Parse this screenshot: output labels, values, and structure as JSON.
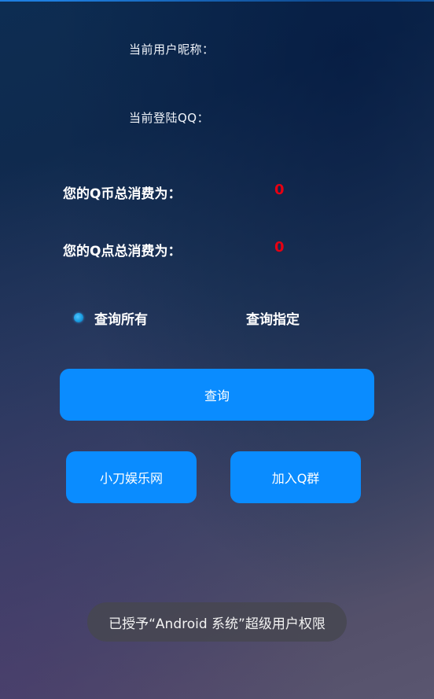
{
  "info": {
    "nickname_label": "当前用户昵称：",
    "qq_label": "当前登陆QQ："
  },
  "stats": {
    "qcoin_label": "您的Q币总消费为：",
    "qcoin_value": "0",
    "qpoint_label": "您的Q点总消费为：",
    "qpoint_value": "0"
  },
  "options": {
    "query_all": "查询所有",
    "query_specific": "查询指定",
    "selected": "查询所有"
  },
  "buttons": {
    "query": "查询",
    "website": "小刀娱乐网",
    "join_group": "加入Q群"
  },
  "toast": {
    "message": "已授予“Android 系统”超级用户权限"
  },
  "colors": {
    "button": "#0a8cff",
    "value": "#e60012",
    "accent_line": "#1e7fe0"
  }
}
